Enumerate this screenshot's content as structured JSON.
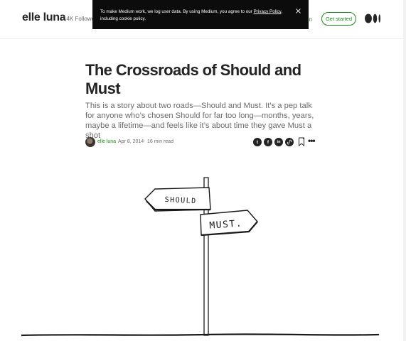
{
  "header": {
    "brand": "elle luna",
    "followers": "14K Followe",
    "sign_in": "n in",
    "get_started": "Get started"
  },
  "cookie_banner": {
    "text_before": "To make Medium work, we log user data. By using Medium, you agree to our ",
    "link": "Privacy Policy",
    "text_after": ", including cookie policy."
  },
  "article": {
    "title": "The Crossroads of Should and Must",
    "subtitle": "This is a story about two roads—Should and Must. It’s a pep talk for anyone who’s chosen Should for far too long—months, years, maybe a lifetime—and feels like it’s about time they gave Must a shot",
    "author": "elle luna",
    "date": "Apr 8, 2014",
    "separator": "·",
    "read_time": "16 min read"
  },
  "share": {
    "twitter": "t",
    "facebook": "f",
    "linkedin": "in",
    "link_icon": "link-icon"
  },
  "illustration": {
    "sign_should": "SHOULD",
    "sign_must": "MUST."
  },
  "colors": {
    "accent_green": "#1a8917",
    "text": "#242424",
    "muted": "#6b6b6b",
    "banner": "#0c0c0c"
  }
}
